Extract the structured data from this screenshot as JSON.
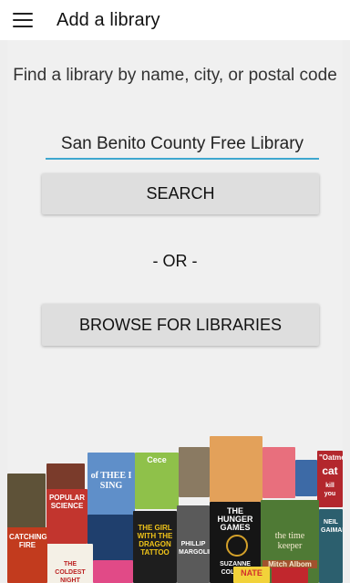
{
  "app_bar": {
    "menu_icon": "hamburger-menu-icon",
    "title": "Add a library"
  },
  "main": {
    "prompt": "Find a library by name, city, or postal code",
    "search_value": "San Benito County Free Library",
    "search_button": "SEARCH",
    "or_divider": "- OR -",
    "browse_button": "BROWSE FOR LIBRARIES"
  },
  "book_collage": {
    "titles": [
      "CATCHING FIRE",
      "POPULAR SCIENCE",
      "of THEE I SING",
      "Cece",
      "THE GIRL WITH THE DRAGON TATTOO",
      "THE HUNGER GAMES",
      "the time keeper",
      "Mitch Albom",
      "NEIL GAIMAN",
      "cat",
      "\"Oatme",
      "kill you",
      "SUZANNE COLLINS",
      "PHILLIP MARGOLIN",
      "THE COLDEST NIGHT",
      "NATE"
    ]
  }
}
